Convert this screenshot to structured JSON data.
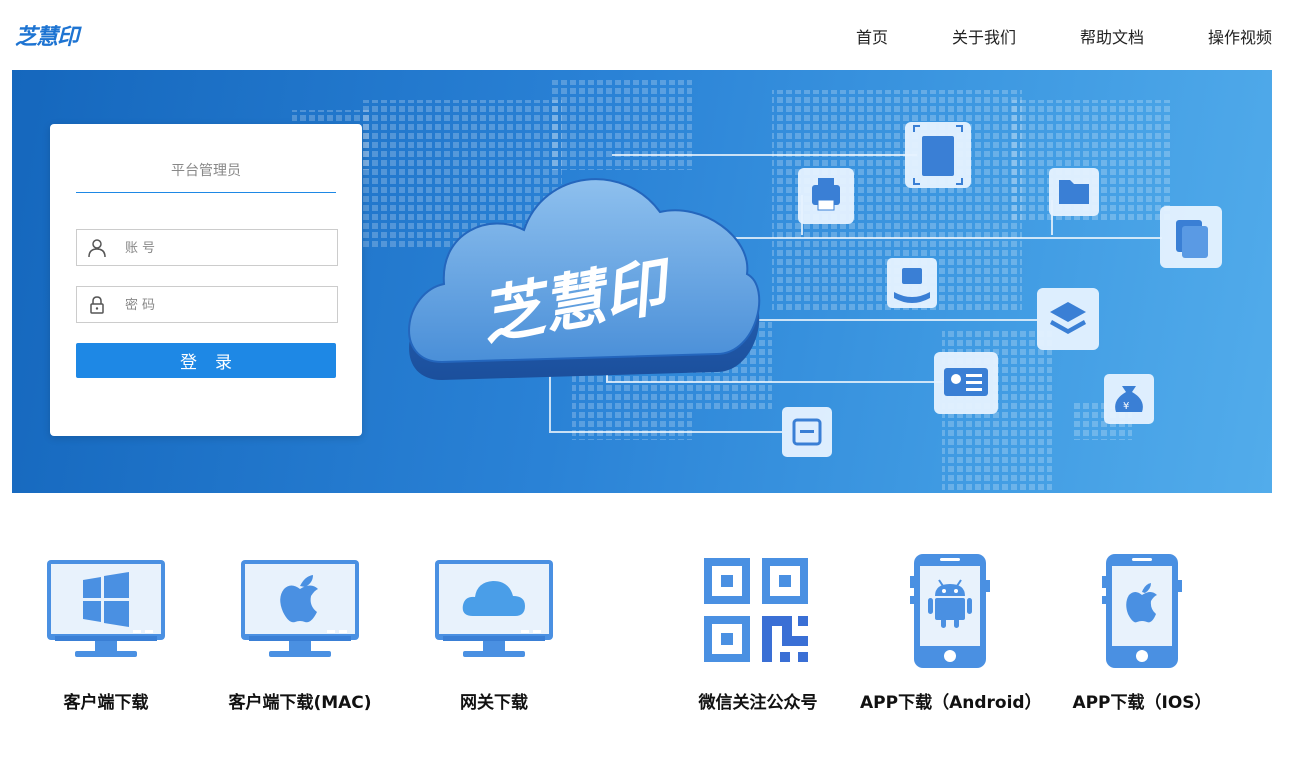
{
  "brand": {
    "logo_text": "芝慧印"
  },
  "nav": [
    "首页",
    "关于我们",
    "帮助文档",
    "操作视频"
  ],
  "banner": {
    "cloud_text": "芝慧印"
  },
  "login": {
    "role": "平台管理员",
    "account_placeholder": "账号",
    "password_placeholder": "密码",
    "submit_label": "登录"
  },
  "downloads": [
    {
      "label": "客户端下载",
      "icon": "windows-monitor-icon"
    },
    {
      "label": "客户端下载(MAC)",
      "icon": "apple-monitor-icon"
    },
    {
      "label": "网关下载",
      "icon": "cloud-monitor-icon"
    },
    {
      "label": "微信关注公众号",
      "icon": "qr-code-icon"
    },
    {
      "label": "APP下载（Android）",
      "icon": "android-phone-icon"
    },
    {
      "label": "APP下载（IOS）",
      "icon": "ios-phone-icon"
    }
  ],
  "colors": {
    "accent": "#1e88e5",
    "brand": "#1e74d2",
    "banner_start": "#1567bd",
    "banner_end": "#52aceb",
    "icon_blue": "#4a90e2"
  }
}
